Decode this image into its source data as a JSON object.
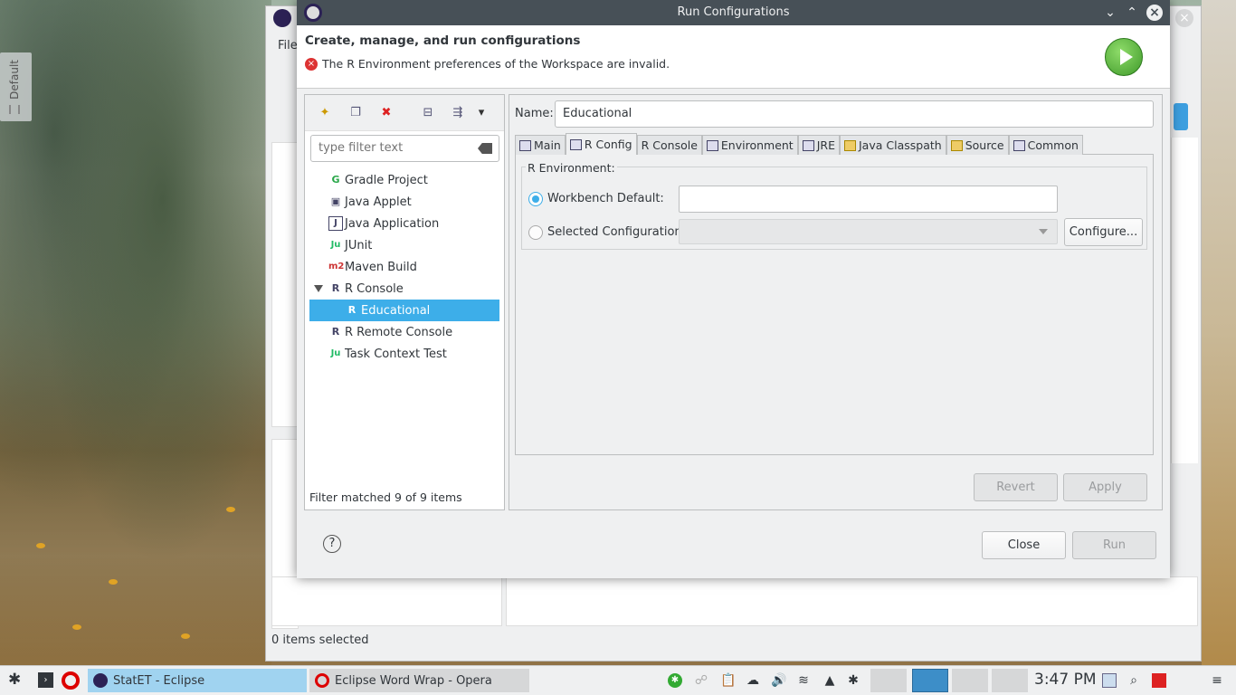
{
  "desktop": {
    "side_tab_label": "Default"
  },
  "eclipse_window": {
    "menu_file": "File",
    "status": "0 items selected"
  },
  "dialog": {
    "title": "Run Configurations",
    "header_title": "Create, manage, and run configurations",
    "error_message": "The R Environment preferences of the Workspace are invalid.",
    "filter_placeholder": "type filter text",
    "tree": [
      {
        "label": "Gradle Project",
        "icon": "G",
        "color": "#2aa84a"
      },
      {
        "label": "Java Applet",
        "icon": "▣",
        "color": "#446"
      },
      {
        "label": "Java Application",
        "icon": "J",
        "color": "#446"
      },
      {
        "label": "JUnit",
        "icon": "Ju",
        "color": "#2b6"
      },
      {
        "label": "Maven Build",
        "icon": "m2",
        "color": "#c33"
      },
      {
        "label": "R Console",
        "icon": "R",
        "color": "#446"
      },
      {
        "label": "Educational",
        "icon": "R",
        "color": "#446"
      },
      {
        "label": "R Remote Console",
        "icon": "R",
        "color": "#446"
      },
      {
        "label": "Task Context Test",
        "icon": "Ju",
        "color": "#2b6"
      }
    ],
    "filter_status": "Filter matched 9 of 9 items",
    "name_label": "Name:",
    "name_value": "Educational",
    "tabs": [
      "Main",
      "R Config",
      "R Console",
      "Environment",
      "JRE",
      "Java Classpath",
      "Source",
      "Common"
    ],
    "group_title": "R Environment:",
    "workbench_default": "Workbench Default:",
    "selected_configuration": "Selected Configuration:",
    "configure_button": "Configure...",
    "revert_button": "Revert",
    "apply_button": "Apply",
    "close_button": "Close",
    "run_button": "Run",
    "help_glyph": "?"
  },
  "taskbar": {
    "task1": "StatET - Eclipse",
    "task2": "Eclipse Word Wrap - Opera",
    "clock": "3:47 PM"
  },
  "colors": {
    "accent": "#3daee9",
    "titlebar": "#475057",
    "error": "#dd3333"
  }
}
